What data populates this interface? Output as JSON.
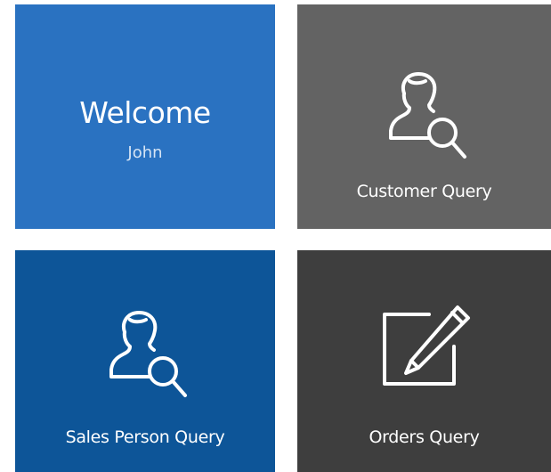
{
  "tiles": {
    "welcome": {
      "title": "Welcome",
      "user_name": "John",
      "color": "#2a72c1"
    },
    "customer_query": {
      "label": "Customer Query",
      "icon": "user-search-icon",
      "color": "#636363"
    },
    "sales_person_query": {
      "label": "Sales Person Query",
      "icon": "user-search-icon",
      "color": "#0d5598"
    },
    "orders_query": {
      "label": "Orders Query",
      "icon": "edit-pencil-icon",
      "color": "#3e3e3e"
    }
  }
}
